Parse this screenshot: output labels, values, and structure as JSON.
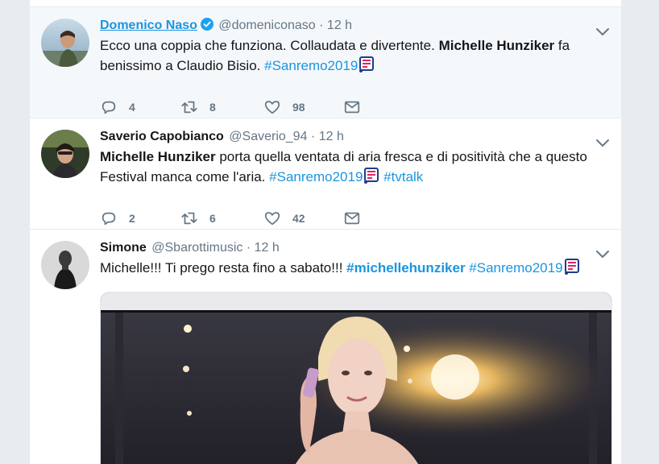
{
  "tweets": [
    {
      "fullname": "Domenico Naso",
      "screen_name": "@domeniconaso",
      "time": "12 h",
      "text_parts": [
        "Ecco una coppia che funziona. Collaudata e divertente.",
        "Michelle Hunziker",
        "fa",
        "benissimo a Claudio Bisio.",
        "#Sanremo2019"
      ],
      "replies": "4",
      "retweets": "8",
      "likes": "98"
    },
    {
      "fullname": "Saverio Capobianco",
      "screen_name": "@Saverio_94",
      "time": "12 h",
      "text_parts": [
        "Michelle Hunziker",
        "porta quella ventata di aria fresca e di positività che a questo",
        "Festival manca come l'aria.",
        "#Sanremo2019",
        "#tvtalk"
      ],
      "replies": "2",
      "retweets": "6",
      "likes": "42"
    },
    {
      "fullname": "Simone",
      "screen_name": "@Sbarottimusic",
      "time": "12 h",
      "text_parts": [
        "Michelle!!! Ti prego resta fino a sabato!!!",
        "#michellehunziker",
        "#Sanremo2019"
      ]
    }
  ],
  "separator": "·",
  "colors": {
    "link": "#1b95e0",
    "secondary": "#657786",
    "highlight_bg": "#f5f8fa"
  },
  "icons": {
    "verified": "verified-badge-icon",
    "caret": "chevron-down-icon",
    "reply": "reply-icon",
    "retweet": "retweet-icon",
    "like": "heart-icon",
    "dm": "envelope-icon",
    "hashflag": "sanremo-hashflag-icon"
  }
}
